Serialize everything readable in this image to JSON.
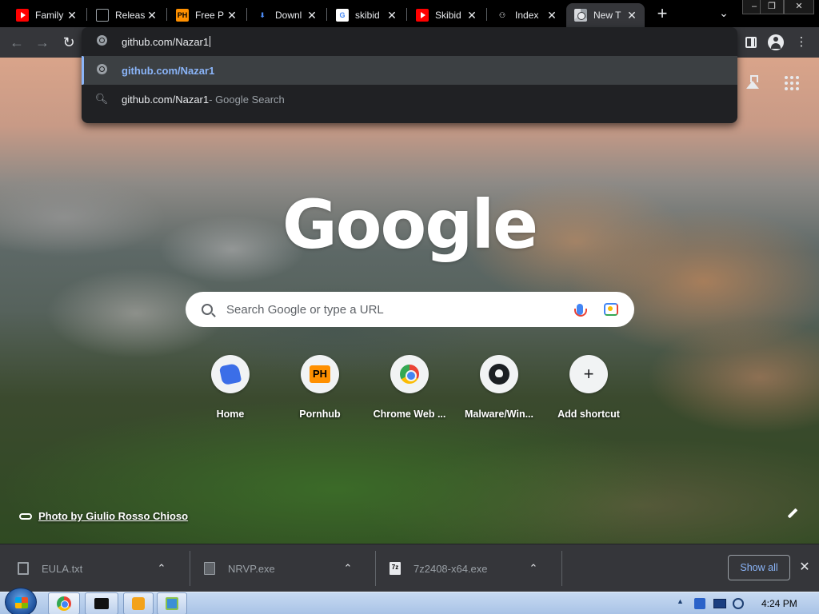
{
  "tabs": [
    {
      "title": "Family",
      "favicon": "youtube-icon"
    },
    {
      "title": "Releas",
      "favicon": "github-icon"
    },
    {
      "title": "Free P",
      "favicon": "pornhub-icon"
    },
    {
      "title": "Downl",
      "favicon": "download-icon"
    },
    {
      "title": "skibid",
      "favicon": "google-icon"
    },
    {
      "title": "Skibid",
      "favicon": "youtube-icon"
    },
    {
      "title": "Index",
      "favicon": "index-icon"
    },
    {
      "title": "New T",
      "favicon": "chrome-icon",
      "active": true
    }
  ],
  "favicon_text": {
    "ph": "PH",
    "g": "G",
    "dl": "⬇",
    "idx": "⚇"
  },
  "new_tab_glyph": "+",
  "tab_search_glyph": "⌄",
  "tab_close_glyph": "✕",
  "window_controls": {
    "minimize": "–",
    "maximize": "❐",
    "close": "✕"
  },
  "toolbar": {
    "back": "←",
    "forward": "→",
    "reload": "↻",
    "menu": "⋮"
  },
  "omnibox": {
    "input_value": "github.com/Nazar1",
    "suggestions": [
      {
        "icon": "globe-icon",
        "text": "github.com/Nazar1",
        "selected": true
      },
      {
        "icon": "search-icon",
        "text": "github.com/Nazar1",
        "suffix": " - Google Search"
      }
    ]
  },
  "ntp": {
    "logo": "Google",
    "search_placeholder": "Search Google or type a URL",
    "shortcuts": [
      {
        "label": "Home",
        "icon": "home-site-icon"
      },
      {
        "label": "Pornhub",
        "icon": "pornhub-icon",
        "text": "PH"
      },
      {
        "label": "Chrome Web ...",
        "icon": "chrome-web-store-icon"
      },
      {
        "label": "Malware/Win...",
        "icon": "github-icon"
      },
      {
        "label": "Add shortcut",
        "icon": "plus-icon",
        "text": "+"
      }
    ],
    "photo_credit": "Photo by Giulio Rosso Chioso"
  },
  "downloads": [
    {
      "name": "EULA.txt",
      "icon": "text-file-icon"
    },
    {
      "name": "NRVP.exe",
      "icon": "exe-file-icon"
    },
    {
      "name": "7z2408-x64.exe",
      "icon": "7zip-file-icon",
      "icon_text": "7z"
    }
  ],
  "download_chevron": "⌃",
  "show_all_label": "Show all",
  "shelf_close_glyph": "✕",
  "taskbar": {
    "clock": "4:24 PM",
    "tray_arrow": "▲"
  },
  "colors": {
    "tab_strip": "#000000",
    "toolbar": "#35363a",
    "omnibox_bg": "#202124",
    "accent": "#8ab4f8",
    "shelf": "#35363a"
  }
}
